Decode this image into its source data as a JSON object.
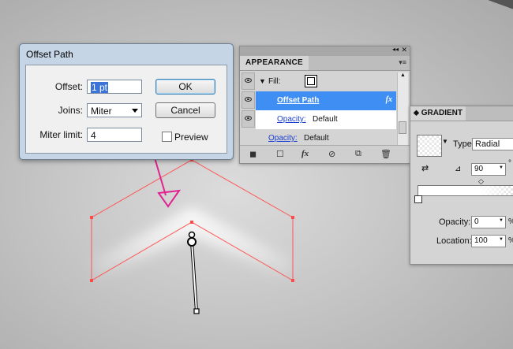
{
  "offset_dialog": {
    "title": "Offset Path",
    "offset_label": "Offset:",
    "offset_value": "1 pt",
    "joins_label": "Joins:",
    "joins_value": "Miter",
    "miter_label": "Miter limit:",
    "miter_value": "4",
    "ok_label": "OK",
    "cancel_label": "Cancel",
    "preview_label": "Preview",
    "preview_checked": false
  },
  "appearance_panel": {
    "tab": "APPEARANCE",
    "fill_label": "Fill:",
    "rows": [
      {
        "label": "Offset Path",
        "selected": true,
        "fx": "fx"
      },
      {
        "label": "Opacity:",
        "value": "Default"
      },
      {
        "label": "Opacity:",
        "value": "Default"
      }
    ],
    "footer_icons": [
      "new-art-icon",
      "stroke-icon",
      "fx-icon",
      "clear-icon",
      "duplicate-icon",
      "delete-icon"
    ]
  },
  "gradient_panel": {
    "tab": "GRADIENT",
    "type_label": "Type:",
    "type_value": "Radial",
    "angle_value": "90",
    "degree_symbol": "°",
    "opacity_label": "Opacity:",
    "opacity_value": "0",
    "location_label": "Location:",
    "location_value": "100",
    "percent": "%"
  },
  "colors": {
    "selection_blue": "#3e8ef4",
    "path_red": "#ff4a4a",
    "annotation_magenta": "#e0248f"
  }
}
